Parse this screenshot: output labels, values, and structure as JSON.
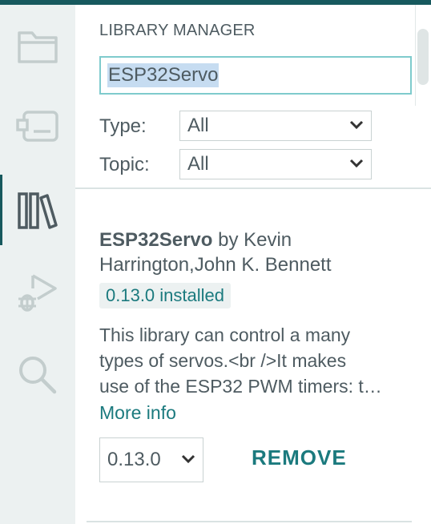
{
  "activity_bar": {
    "items": [
      {
        "icon": "folder-icon",
        "active": false
      },
      {
        "icon": "board-icon",
        "active": false
      },
      {
        "icon": "library-icon",
        "active": true
      },
      {
        "icon": "debug-icon",
        "active": false
      },
      {
        "icon": "search-icon",
        "active": false
      }
    ]
  },
  "library_manager": {
    "title": "LIBRARY MANAGER",
    "search": {
      "value": "ESP32Servo"
    },
    "filters": {
      "type": {
        "label": "Type:",
        "value": "All"
      },
      "topic": {
        "label": "Topic:",
        "value": "All"
      }
    },
    "result": {
      "name": "ESP32Servo",
      "by": "by Kevin",
      "authors": "Harrington,John K. Bennett",
      "installed_badge": "0.13.0 installed",
      "description_lines": [
        "This library can control a many",
        "types of servos.<br />It makes",
        "use of the ESP32 PWM timers: t…"
      ],
      "more_info": "More info",
      "version_select": "0.13.0",
      "remove_label": "REMOVE"
    }
  },
  "colors": {
    "accent": "#17595e",
    "link": "#1b7a7e",
    "text": "#4e5b61",
    "sidebar_bg": "#ecf1f1",
    "search_border": "#7fcbcd",
    "selection": "#c6dcf1"
  }
}
